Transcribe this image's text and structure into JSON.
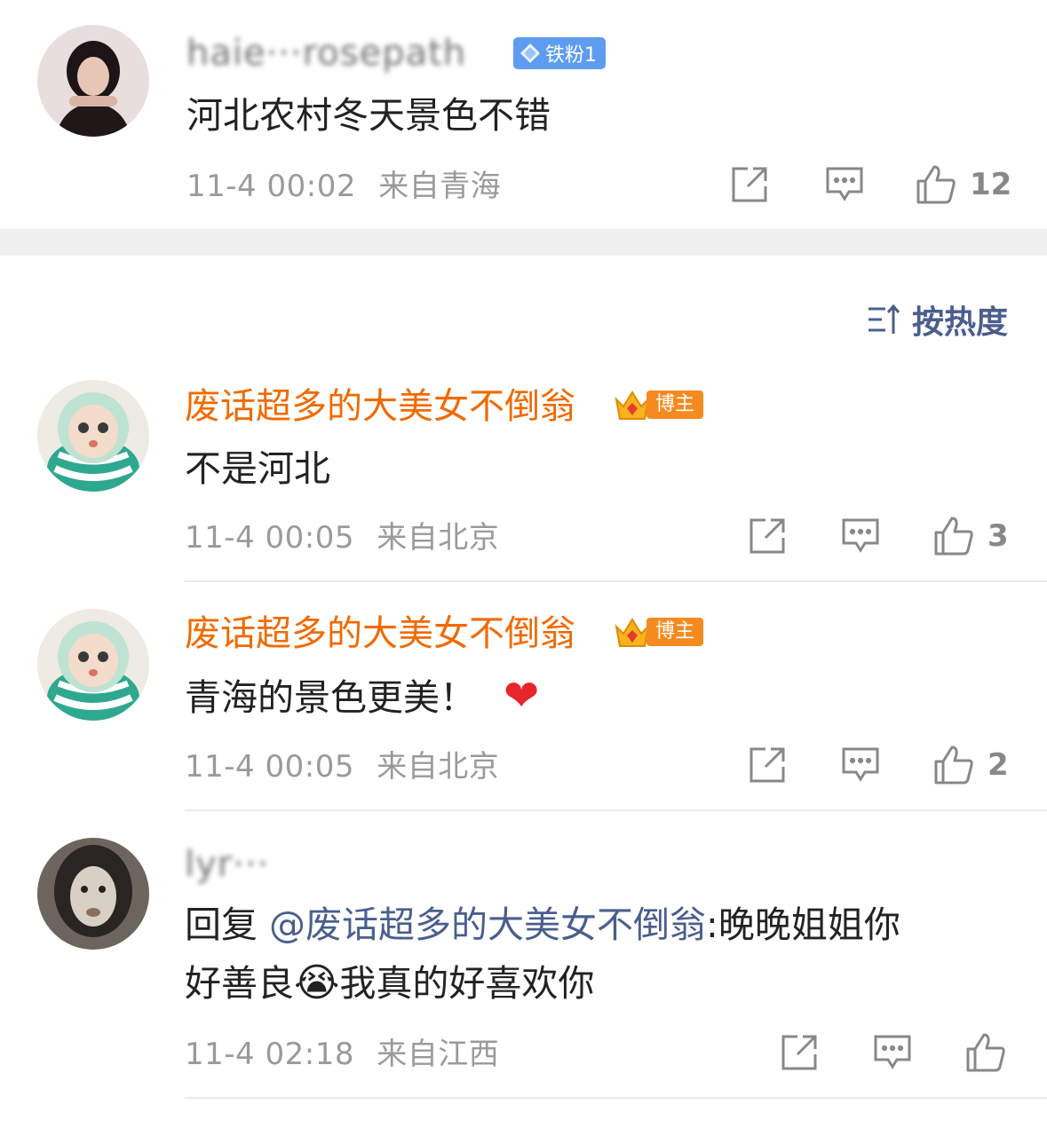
{
  "comments": [
    {
      "username": "haie···rosepath",
      "username_obscured": true,
      "badge": "铁粉1",
      "text": "河北农村冬天景色不错",
      "time": "11-4 00:02",
      "source": "来自青海",
      "likes": "12"
    },
    {
      "username": "废话超多的大美女不倒翁",
      "badge": "博主",
      "text": "不是河北",
      "time": "11-4 00:05",
      "source": "来自北京",
      "likes": "3"
    },
    {
      "username": "废话超多的大美女不倒翁",
      "badge": "博主",
      "text": "青海的景色更美！",
      "emoji": "❤",
      "time": "11-4 00:05",
      "source": "来自北京",
      "likes": "2"
    },
    {
      "username": "lyr···",
      "username_obscured": true,
      "reply_prefix": "回复 ",
      "mention": "@废话超多的大美女不倒翁",
      "text_line1_rest": ":晚晚姐姐你",
      "text_line2_a": "好善良",
      "emoji": "😭",
      "text_line2_b": "我真的好喜欢你",
      "time": "11-4 02:18",
      "source": "来自江西",
      "likes": ""
    }
  ],
  "sort": {
    "label": "按热度"
  },
  "icons": {
    "share": "share-icon",
    "comment": "comment-icon",
    "like": "like-icon",
    "sort": "sort-icon",
    "fan_badge": "diamond-icon",
    "host_badge": "crown-icon"
  },
  "colors": {
    "host_name": "#f06a00",
    "mention": "#4a5e8e",
    "meta": "#9a9a9a",
    "fan_badge": "#5d9cf0",
    "host_badge": "#f58a1f"
  }
}
